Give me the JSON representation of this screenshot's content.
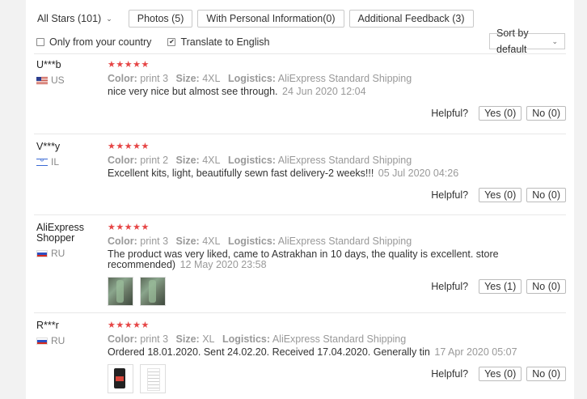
{
  "filters": {
    "star_select": "All Stars (101)",
    "buttons": [
      "Photos (5)",
      "With Personal Information(0)",
      "Additional Feedback (3)"
    ]
  },
  "options": {
    "country_only": "Only from your country",
    "translate": "Translate to English",
    "sort": "Sort by default"
  },
  "labels": {
    "color": "Color:",
    "size": "Size:",
    "logistics": "Logistics:",
    "helpful": "Helpful?",
    "yes": "Yes",
    "no": "No"
  },
  "reviews": [
    {
      "user": "U***b",
      "country": "US",
      "stars": "★★★★★",
      "color": "print 3",
      "size": "4XL",
      "logistics": "AliExpress Standard Shipping",
      "text": "nice very nice but almost see through.",
      "date": "24 Jun 2020 12:04",
      "yes": "Yes (0)",
      "no": "No (0)"
    },
    {
      "user": "V***y",
      "country": "IL",
      "stars": "★★★★★",
      "color": "print 2",
      "size": "4XL",
      "logistics": "AliExpress Standard Shipping",
      "text": "Excellent kits, light, beautifully sewn fast delivery-2 weeks!!!",
      "date": "05 Jul 2020 04:26",
      "yes": "Yes (0)",
      "no": "No (0)"
    },
    {
      "user": "AliExpress Shopper",
      "country": "RU",
      "stars": "★★★★★",
      "color": "print 3",
      "size": "4XL",
      "logistics": "AliExpress Standard Shipping",
      "text": "The product was very liked, came to Astrakhan in 10 days, the quality is excellent. store recommended)",
      "date": "12 May 2020 23:58",
      "yes": "Yes (1)",
      "no": "No (0)"
    },
    {
      "user": "R***r",
      "country": "RU",
      "stars": "★★★★★",
      "color": "print 3",
      "size": "XL",
      "logistics": "AliExpress Standard Shipping",
      "text": "Ordered 18.01.2020. Sent 24.02.20. Received 17.04.2020. Generally tin",
      "date": "17 Apr 2020 05:07",
      "yes": "Yes (0)",
      "no": "No (0)"
    }
  ],
  "colors": {
    "star": "#e64545",
    "muted": "#999999",
    "text": "#333333"
  }
}
